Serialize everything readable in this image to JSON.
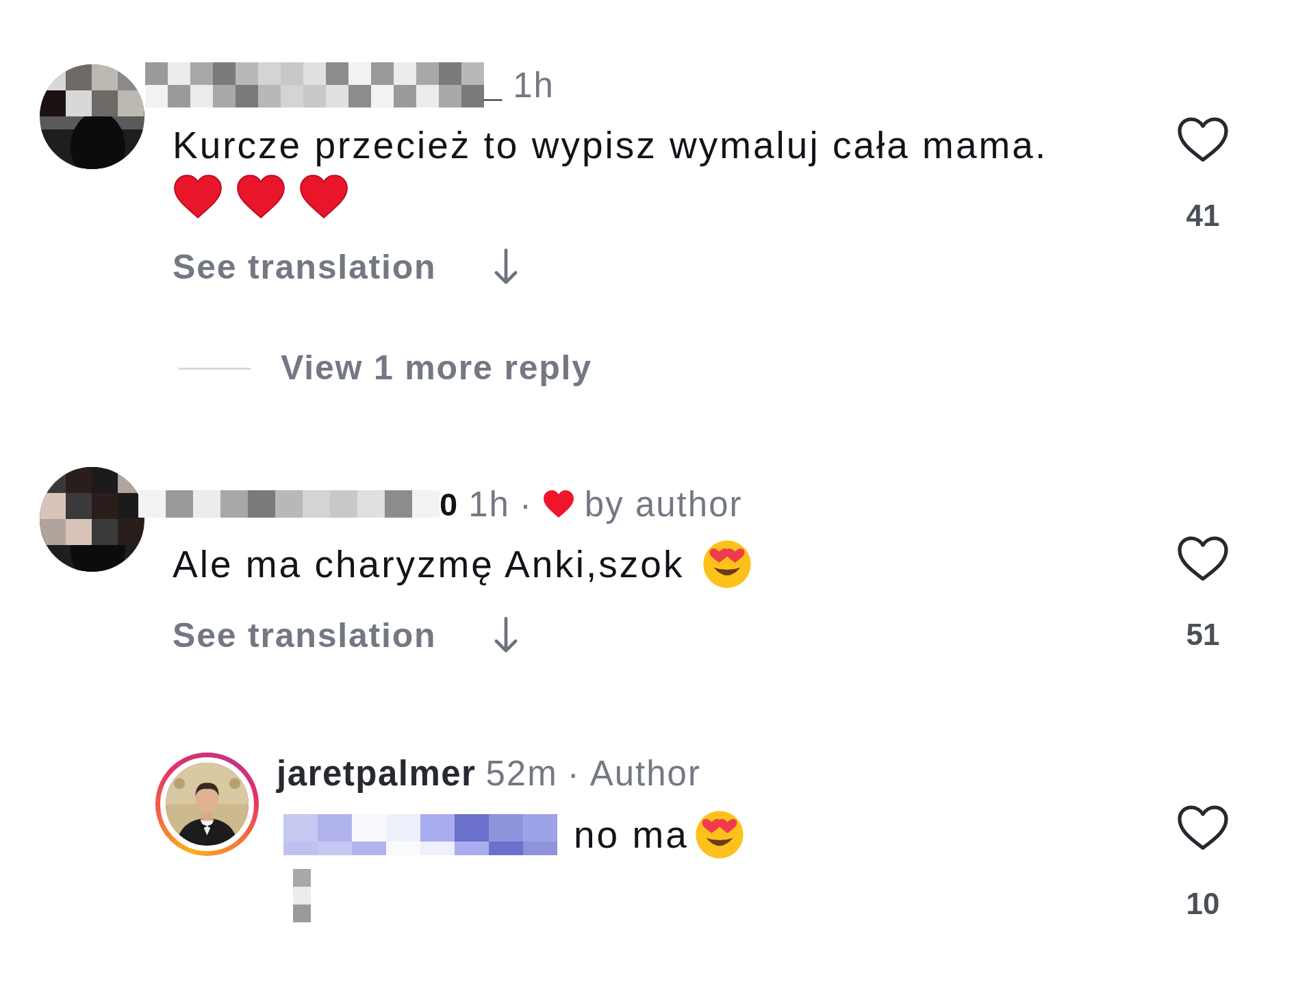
{
  "comments": [
    {
      "username_tail": "_",
      "time": "1h",
      "liked_by_author": false,
      "text": "Kurcze przecież to wypisz wymaluj cała mama.",
      "emojis": [
        {
          "kind": "heart"
        },
        {
          "kind": "heart"
        },
        {
          "kind": "heart"
        }
      ],
      "see_translation": "See translation",
      "likes": "41",
      "liked": false,
      "view_replies": "View 1 more reply"
    },
    {
      "username_tail": "0",
      "time": "1h",
      "separator": "·",
      "liked_by_author": true,
      "by_author": "by author",
      "text": "Ale ma charyzmę Anki,szok",
      "emojis": [
        {
          "kind": "heart-eyes"
        }
      ],
      "see_translation": "See translation",
      "likes": "51",
      "liked": false,
      "replies": [
        {
          "username": "jaretpalmer",
          "time": "52m",
          "separator": "·",
          "badge": "Author",
          "text": "no ma",
          "emojis": [
            {
              "kind": "heart-eyes"
            }
          ],
          "likes": "10",
          "liked": false
        }
      ]
    }
  ]
}
